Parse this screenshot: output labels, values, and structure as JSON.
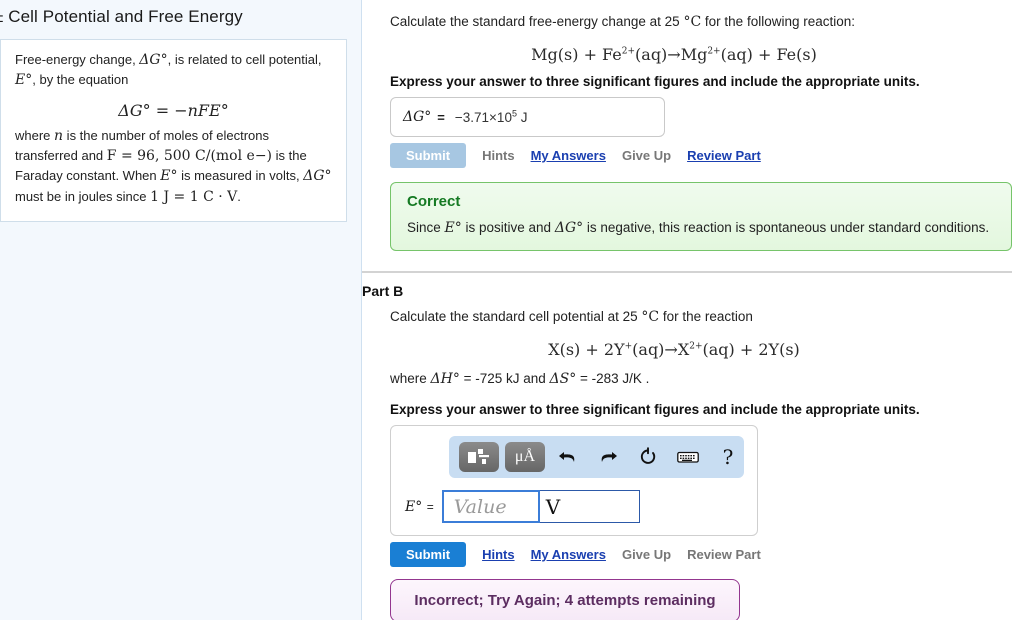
{
  "left_panel": {
    "title": "± Cell Potential and Free Energy",
    "hint": {
      "line1_a": "Free-energy change, ",
      "line1_sym1": "ΔG°",
      "line1_b": ", is related to cell potential, ",
      "line1_sym2": "E°",
      "line1_c": ", by the equation",
      "equation": "ΔG° = −nFE°",
      "line2_a": "where ",
      "line2_sym1": "n",
      "line2_b": " is the number of moles of electrons transferred and ",
      "line2_sym2": "F = 96, 500 C/(mol e−)",
      "line2_c": " is the Faraday constant. When ",
      "line2_sym3": "E°",
      "line2_d": " is measured in volts, ",
      "line2_sym4": "ΔG°",
      "line2_e": " must be in joules since ",
      "line2_sym5": "1 J = 1 C · V",
      "line2_f": "."
    }
  },
  "part_a": {
    "question_a": "Calculate the standard free-energy change at 25 ",
    "question_temp": "°C",
    "question_b": " for the following reaction:",
    "reaction": "Mg(s) + Fe2+(aq)→Mg2+(aq) + Fe(s)",
    "instruction": "Express your answer to three significant figures and include the appropriate units.",
    "answer_label": "ΔG°",
    "answer_equals": "=",
    "answer_value": "−3.71×105 J",
    "submit_label": "Submit",
    "submit_state": "disabled",
    "links": [
      {
        "label": "Hints",
        "active": false
      },
      {
        "label": "My Answers",
        "active": true
      },
      {
        "label": "Give Up",
        "active": false
      },
      {
        "label": "Review Part",
        "active": true
      }
    ],
    "feedback": {
      "title": "Correct",
      "text_a": "Since ",
      "sym1": "E°",
      "text_b": " is positive and ",
      "sym2": "ΔG°",
      "text_c": " is negative, this reaction is spontaneous under standard conditions.",
      "border_color": "#76c46a",
      "title_color": "#157a23"
    }
  },
  "part_b": {
    "label": "Part B",
    "question_a": "Calculate the standard cell potential at 25 ",
    "question_temp": "°C",
    "question_b": " for the reaction",
    "reaction": "X(s) + 2Y+(aq)→X2+(aq) + 2Y(s)",
    "given_a": "where ",
    "given_sym1": "ΔH°",
    "given_b": " = -725 kJ and ",
    "given_sym2": "ΔS°",
    "given_c": " = -283 J/K .",
    "instruction": "Express your answer to three significant figures and include the appropriate units.",
    "toolbar": {
      "template_icon": "template-icon",
      "units_icon": "μÅ",
      "undo_icon": "↰",
      "redo_icon": "↱",
      "reset_icon": "↻",
      "keyboard_icon": "keyboard-icon",
      "help_icon": "?",
      "background_color": "#c8ddf2"
    },
    "answer_label": "E°",
    "answer_equals": "=",
    "value_placeholder": "Value",
    "unit_value": "V",
    "submit_label": "Submit",
    "submit_state": "active",
    "links": [
      {
        "label": "Hints",
        "active": true
      },
      {
        "label": "My Answers",
        "active": true
      },
      {
        "label": "Give Up",
        "active": false
      },
      {
        "label": "Review Part",
        "active": false
      }
    ],
    "feedback": {
      "text": "Incorrect; Try Again; 4 attempts remaining",
      "border_color": "#93368f",
      "text_color": "#5c2d61"
    }
  }
}
